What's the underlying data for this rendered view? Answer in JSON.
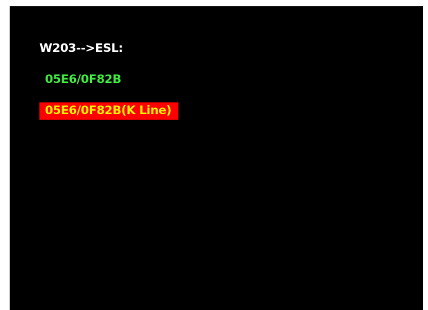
{
  "screen": {
    "title": "W203-->ESL:",
    "items": [
      {
        "label": "05E6/0F82B",
        "color": "#3ee83e",
        "selected": false
      },
      {
        "label": "05E6/0F82B(K Line)",
        "color": "#f0f000",
        "highlight": "#ff0000",
        "selected": true
      }
    ]
  },
  "colors": {
    "background": "#000000",
    "title_text": "#ffffff"
  }
}
